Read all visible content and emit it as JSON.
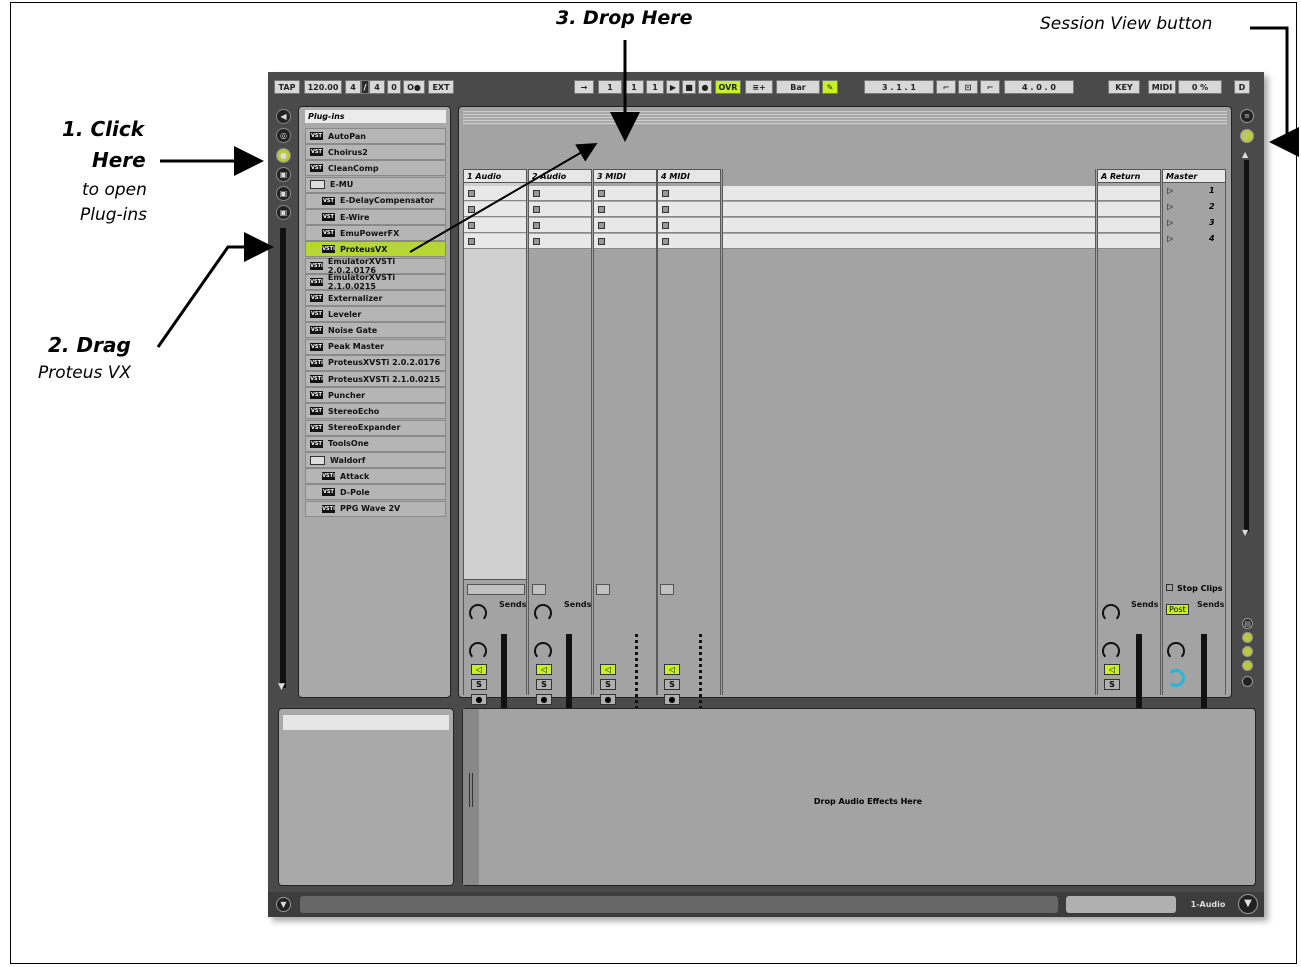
{
  "annotations": {
    "step1_title_a": "1. Click",
    "step1_title_b": "Here",
    "step1_desc_a": "to open",
    "step1_desc_b": "Plug-ins",
    "step2_title": "2. Drag",
    "step2_desc": "Proteus VX",
    "step3_title": "3. Drop Here",
    "session_view": "Session View button"
  },
  "transport": {
    "tap": "TAP",
    "tempo": "120.00",
    "sig_num": "4",
    "sig_den": "4",
    "zero": "0",
    "metro": "O●",
    "ext": "EXT",
    "follow": "→",
    "pos_a": "1",
    "pos_b": "1",
    "pos_c": "1",
    "play": "▶",
    "stop": "■",
    "rec": "●",
    "ovr": "OVR",
    "overdub": "≡+",
    "quant": "Bar",
    "draw": "✎",
    "loop_pos": "3 . 1 . 1",
    "loop_len": "4 . 0 . 0",
    "key": "KEY",
    "midi": "MIDI",
    "cpu": "0 %",
    "d": "D"
  },
  "browser": {
    "title": "Plug-ins",
    "items": [
      {
        "label": "AutoPan",
        "type": "vst",
        "indent": false
      },
      {
        "label": "Choirus2",
        "type": "vst",
        "indent": false
      },
      {
        "label": "CleanComp",
        "type": "vst",
        "indent": false
      },
      {
        "label": "E-MU",
        "type": "folder",
        "indent": false
      },
      {
        "label": "E-DelayCompensator",
        "type": "vst",
        "indent": true
      },
      {
        "label": "E-Wire",
        "type": "vst",
        "indent": true
      },
      {
        "label": "EmuPowerFX",
        "type": "vst",
        "indent": true
      },
      {
        "label": "ProteusVX",
        "type": "vsti",
        "indent": true,
        "selected": true
      },
      {
        "label": "EmulatorXVSTi 2.0.2.0176",
        "type": "vsti",
        "indent": false
      },
      {
        "label": "EmulatorXVSTi 2.1.0.0215",
        "type": "vsti",
        "indent": false
      },
      {
        "label": "Externalizer",
        "type": "vst",
        "indent": false
      },
      {
        "label": "Leveler",
        "type": "vst",
        "indent": false
      },
      {
        "label": "Noise Gate",
        "type": "vst",
        "indent": false
      },
      {
        "label": "Peak Master",
        "type": "vst",
        "indent": false
      },
      {
        "label": "ProteusXVSTi 2.0.2.0176",
        "type": "vsti",
        "indent": false
      },
      {
        "label": "ProteusXVSTi 2.1.0.0215",
        "type": "vsti",
        "indent": false
      },
      {
        "label": "Puncher",
        "type": "vst",
        "indent": false
      },
      {
        "label": "StereoEcho",
        "type": "vst",
        "indent": false
      },
      {
        "label": "StereoExpander",
        "type": "vst",
        "indent": false
      },
      {
        "label": "ToolsOne",
        "type": "vst",
        "indent": false
      },
      {
        "label": "Waldorf",
        "type": "folder",
        "indent": false
      },
      {
        "label": "Attack",
        "type": "vsti",
        "indent": true
      },
      {
        "label": "D-Pole",
        "type": "vst",
        "indent": true
      },
      {
        "label": "PPG Wave 2V",
        "type": "vsti",
        "indent": true
      }
    ]
  },
  "tracks": {
    "t1": "1 Audio",
    "t2": "2 Audio",
    "t3": "3 MIDI",
    "t4": "4 MIDI",
    "ret": "A Return",
    "master": "Master"
  },
  "scenes": [
    "1",
    "2",
    "3",
    "4"
  ],
  "mixer": {
    "sends": "Sends",
    "stop_clips": "Stop Clips",
    "post": "Post",
    "solo": "S",
    "arm": "●",
    "n1": "1",
    "n2": "2",
    "n3": "3",
    "n4": "4",
    "na": "A",
    "knob_a": "A"
  },
  "detail": {
    "drop_text": "Drop Audio Effects Here",
    "track_name": "1-Audio"
  },
  "icons": {
    "session_icon": "session-view-icon",
    "plugin_icon": "plugin-browser-icon"
  }
}
